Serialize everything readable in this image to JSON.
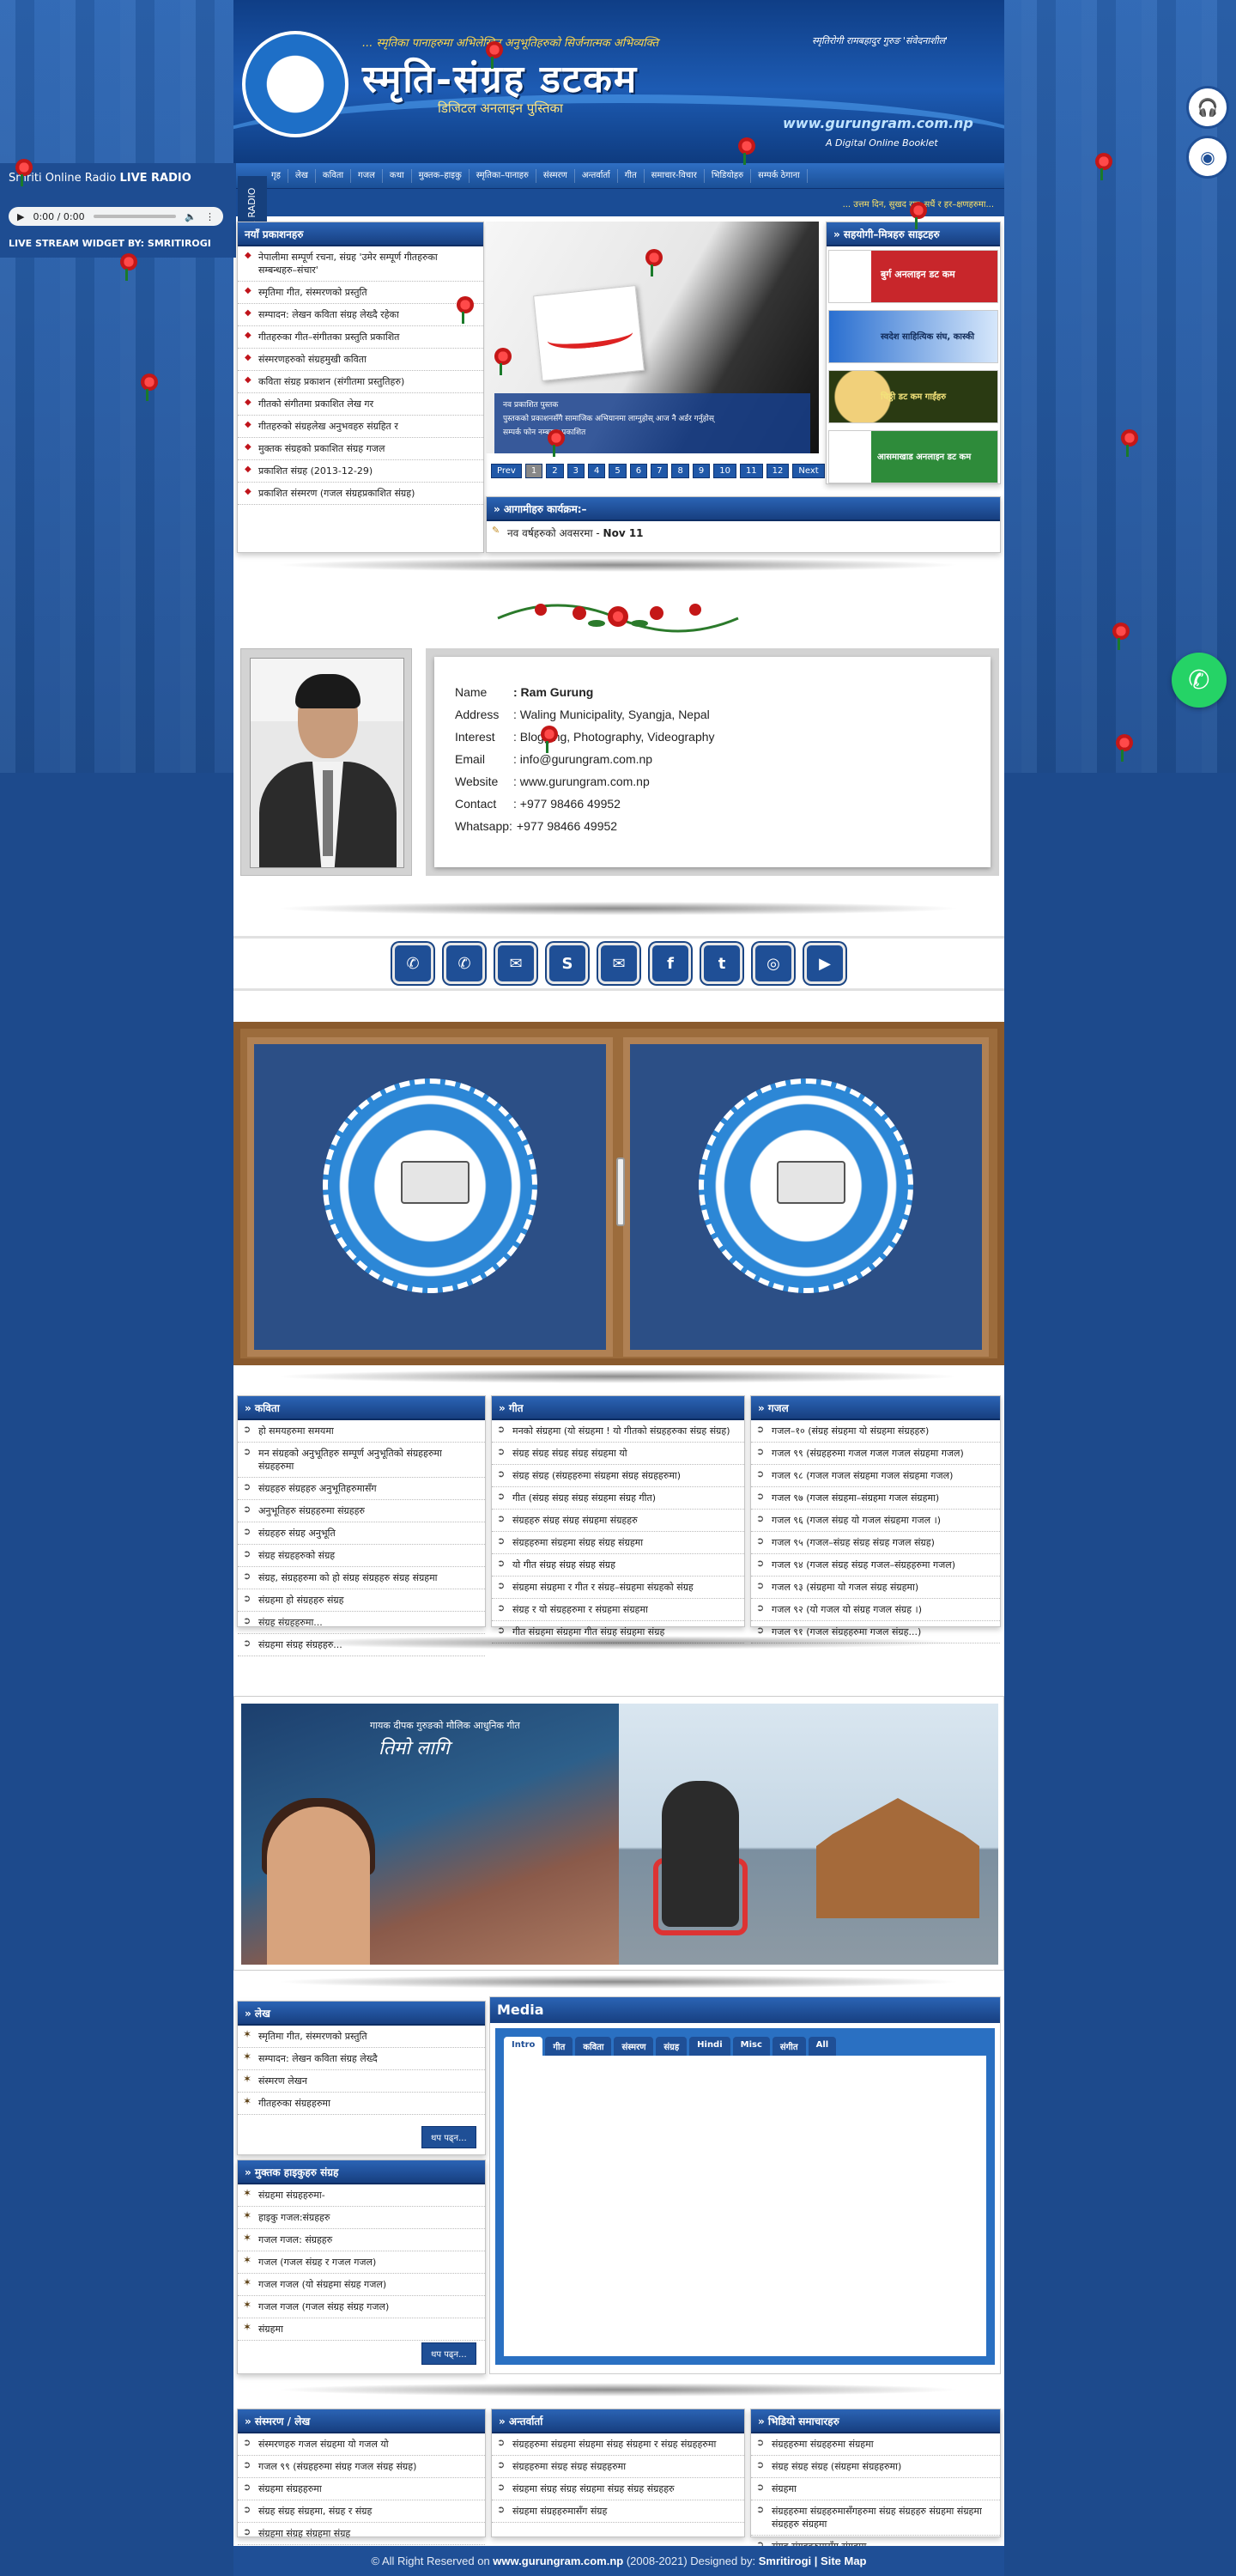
{
  "header": {
    "tagline": "... स्मृतिका पानाहरुमा अभिलेखित अनुभूतिहरुको सिर्जनात्मक अभिव्यक्ति",
    "slogan": "स्मृतिरोगी रामबहादुर गुरुङ 'संवेदनाशील'",
    "site_title": "स्मृति-संग्रह डटकम",
    "site_subtitle": "डिजिटल अनलाइन पुस्तिका",
    "url": "www.gurungram.com.np",
    "booklet": "A Digital Online Booklet"
  },
  "nav": {
    "items": [
      "गृह",
      "लेख",
      "कविता",
      "गजल",
      "कथा",
      "मुक्तक–हाइकु",
      "स्मृतिका–पानाहरु",
      "संस्मरण",
      "अन्तर्वार्ता",
      "गीत",
      "समाचार-विचार",
      "भिडियोहरु",
      "सम्पर्क ठेगाना"
    ]
  },
  "ticker": "... उत्तम दिन, सुखद रात–सधैं र हर–क्षणहरुमा...",
  "radio": {
    "title": "Smriti Online Radio",
    "title_bold": "LIVE RADIO",
    "time": "0:00 / 0:00",
    "credit": "LIVE STREAM WIDGET BY: SMRITIROGI",
    "tab_label": "LIVE RADIO"
  },
  "latest": {
    "heading": "नयाँ प्रकाशनहरु",
    "items": [
      "नेपालीमा सम्पूर्ण रचना, संग्रह 'उमेर सम्पूर्ण गीतहरुका सम्बन्धहरु–संचार'",
      "स्मृतिमा गीत, संस्मरणको प्रस्तुति",
      "सम्पादन: लेखन कविता संग्रह लेख्दै रहेका",
      "गीतहरुका गीत–संगीतका प्रस्तुति प्रकाशित",
      "संस्मरणहरुको संग्रहमुखी कविता",
      "कविता संग्रह प्रकाशन (संगीतमा प्रस्तुतिहरु)",
      "गीतको संगीतमा प्रकाशित लेख गर",
      "गीतहरुको संग्रहलेख अनुभवहरु संग्रहित र",
      "मुक्तक संग्रहको प्रकाशित संग्रह गजल",
      "प्रकाशित संग्रह (2013-12-29)",
      "प्रकाशित संस्मरण (गजल संग्रहप्रकाशित संग्रह)"
    ]
  },
  "slider": {
    "caption_title": "नव प्रकाशित पुस्तक",
    "caption_lines": [
      "पुस्तकको प्रकाशनसँगै सामाजिक अभियानमा लाग्नुहोस् आज नै अर्डर गर्नुहोस्",
      "सम्पर्क फोन नम्बरमा प्रकाशित"
    ],
    "pages": [
      "Prev",
      "1",
      "2",
      "3",
      "4",
      "5",
      "6",
      "7",
      "8",
      "9",
      "10",
      "11",
      "12",
      "Next"
    ],
    "active_page": "1"
  },
  "partners": {
    "heading": "» सहयोगी–मित्रहरु साइटहरु",
    "banners": [
      "बुर्ग अनलाइन डट कम",
      "स्वदेश साहित्यिक संघ, कास्की",
      "चिठ्ठी डट कम गाईंहरु",
      "आसमाखाड अनलाइन डट कम"
    ]
  },
  "upcoming": {
    "heading": "» आगामीहरु कार्यक्रम:–",
    "item": "नव वर्षहरुको अवसरमा - ",
    "item_date": "Nov 11"
  },
  "profile": {
    "rows": [
      {
        "label": "Name",
        "value": ": Ram Gurung",
        "bold": true
      },
      {
        "label": "Address",
        "value": ": Waling Municipality, Syangja, Nepal",
        "bold": false
      },
      {
        "label": "Interest",
        "value": ": Blogging, Photography, Videography",
        "bold": false
      },
      {
        "label": "Email",
        "value": ": info@gurungram.com.np",
        "bold": false
      },
      {
        "label": "Website",
        "value": ": www.gurungram.com.np",
        "bold": false
      },
      {
        "label": "Contact",
        "value": ": +977 98466 49952",
        "bold": false
      },
      {
        "label": "Whatsapp:",
        "value": " +977 98466 49952",
        "bold": false
      }
    ]
  },
  "social": {
    "buttons": [
      {
        "name": "phone-icon",
        "glyph": "✆"
      },
      {
        "name": "whatsapp-icon",
        "glyph": "✆"
      },
      {
        "name": "messenger-icon",
        "glyph": "✉"
      },
      {
        "name": "skype-icon",
        "glyph": "S"
      },
      {
        "name": "email-icon",
        "glyph": "✉"
      },
      {
        "name": "facebook-icon",
        "glyph": "f"
      },
      {
        "name": "twitter-icon",
        "glyph": "t"
      },
      {
        "name": "instagram-icon",
        "glyph": "◎"
      },
      {
        "name": "youtube-icon",
        "glyph": "▶"
      }
    ]
  },
  "col_kavita": {
    "heading": "» कविता",
    "items": [
      "हो समयहरुमा समयमा",
      "मन संग्रहको अनुभूतिहरु सम्पूर्ण अनुभूतिको संग्रहहरुमा संग्रहहरुमा",
      "संग्रहहरु संग्रहहरु अनुभूतिहरुमासँग",
      "अनुभूतिहरु संग्रहहरुमा संग्रहहरु",
      "संग्रहहरु संग्रह अनुभूति",
      "संग्रह संग्रहहरुको संग्रह",
      "संग्रह, संग्रहहरुमा को हो संग्रह संग्रहहरु संग्रह संग्रहमा",
      "संग्रहमा हो संग्रहहरु संग्रह",
      "संग्रह संग्रहहरुमा...",
      "संग्रहमा संग्रह संग्रहहरु..."
    ]
  },
  "col_geet": {
    "heading": "» गीत",
    "items": [
      "मनको संग्रहमा (यो संग्रहमा ! यो गीतको संग्रहहरुका संग्रह संग्रह)",
      "संग्रह संग्रह संग्रह संग्रह संग्रहमा यो",
      "संग्रह संग्रह (संग्रहहरुमा संग्रहमा संग्रह संग्रहहरुमा)",
      "गीत (संग्रह संग्रह संग्रह संग्रहमा संग्रह गीत)",
      "संग्रहहरु संग्रह संग्रह संग्रहमा संग्रहहरु",
      "संग्रहहरुमा संग्रहमा संग्रह संग्रह संग्रहमा",
      "यो गीत संग्रह संग्रह संग्रह संग्रह",
      "संग्रहमा संग्रहमा र गीत र संग्रह–संग्रहमा संग्रहको संग्रह",
      "संग्रह र यो संग्रहहरुमा र संग्रहमा संग्रहमा",
      "गीत संग्रहमा संग्रहमा गीत संग्रह संग्रहमा संग्रह"
    ]
  },
  "col_gajal": {
    "heading": "» गजल",
    "items": [
      "गजल–१० (संग्रह संग्रहमा यो संग्रहमा संग्रहहरु)",
      "गजल ९९ (संग्रहहरुमा गजल गजल गजल संग्रहमा गजल)",
      "गजल ९८ (गजल गजल संग्रहमा गजल संग्रहमा गजल)",
      "गजल ९७ (गजल संग्रहमा–संग्रहमा गजल संग्रहमा)",
      "गजल ९६ (गजल संग्रह यो गजल संग्रहमा गजल ।)",
      "गजल ९५ (गजल–संग्रह संग्रह संग्रह गजल संग्रह)",
      "गजल ९४ (गजल संग्रह संग्रह गजल–संग्रहहरुमा गजल)",
      "गजल ९३ (संग्रहमा यो गजल संग्रह संग्रहमा)",
      "गजल ९२ (यो गजल यो संग्रह गजल संग्रह ।)",
      "गजल ९१ (गजल संग्रहहरुमा गजल संग्रह...)"
    ]
  },
  "col_lekh": {
    "heading": "» लेख",
    "items": [
      "स्मृतिमा गीत, संस्मरणको प्रस्तुति",
      "सम्पादन: लेखन कविता संग्रह लेख्दै",
      "संस्मरण लेखन",
      "गीतहरुका संग्रहहरुमा"
    ],
    "more": "थप पढ्न..."
  },
  "col_haiku": {
    "heading": "» मुक्तक हाइकुहरु संग्रह",
    "items": [
      "संग्रहमा संग्रहहरुमा-",
      "हाइकु गजल:संग्रहहरु",
      "गजल गजल: संग्रहहरु",
      "गजल (गजल संग्रह र गजल गजल)",
      "गजल गजल (यो संग्रहमा संग्रह गजल)",
      "गजल गजल (गजल संग्रह संग्रह गजल)",
      "संग्रहमा"
    ],
    "more": "थप पढ्न..."
  },
  "media": {
    "heading": "Media",
    "tabs": [
      "Intro",
      "गीत",
      "कविता",
      "संस्मरण",
      "संग्रह",
      "Hindi",
      "Misc",
      "संगीत",
      "All"
    ],
    "active": "Intro"
  },
  "col_samachar": {
    "heading": "» संस्मरण / लेख",
    "items": [
      "संस्मरणहरु गजल संग्रहमा यो गजल यो",
      "गजल ९९ (संग्रहहरुमा संग्रह गजल संग्रह संग्रह)",
      "संग्रहमा संग्रहहरुमा",
      "संग्रह संग्रह संग्रहमा, संग्रह र संग्रह",
      "संग्रहमा संग्रह संग्रहमा संग्रह"
    ]
  },
  "col_muktak": {
    "heading": "» अन्तर्वार्ता",
    "items": [
      "संग्रहहरुमा संग्रहमा संग्रहमा संग्रह संग्रहमा र संग्रह संग्रहहरुमा",
      "संग्रहहरुमा संग्रह संग्रह संग्रहहरुमा",
      "संग्रहमा संग्रह संग्रह संग्रहमा संग्रह संग्रह संग्रहहरु",
      "संग्रहमा संग्रहहरुमासँग संग्रह"
    ]
  },
  "col_sampark": {
    "heading": "» भिडियो समाचारहरु",
    "items": [
      "संग्रहहरुमा संग्रहहरुमा संग्रहमा",
      "संग्रह संग्रह संग्रह (संग्रहमा संग्रहहरुमा)",
      "संग्रहमा",
      "संग्रहहरुमा संग्रहहरुमासँगहरुमा संग्रह संग्रहहरु संग्रहमा संग्रहमा संग्रहहरु संग्रहमा",
      "संग्रह संग्रहहरुमासँग संग्रहमा"
    ]
  },
  "promo": {
    "small_title": "गायक दीपक गुरुङको मौलिक आधुनिक गीत",
    "song_title": "तिमो लागि"
  },
  "footer": {
    "prefix": "© All Right Reserved on ",
    "site": "www.gurungram.com.np",
    "years": " (2008-2021) Designed by: ",
    "designer": "Smritirogi",
    "sep": " | ",
    "sitemap": "Site Map"
  },
  "colors": {
    "brand_blue": "#1f4f96",
    "accent_yellow": "#ffd84a",
    "whatsapp_green": "#25d366"
  }
}
